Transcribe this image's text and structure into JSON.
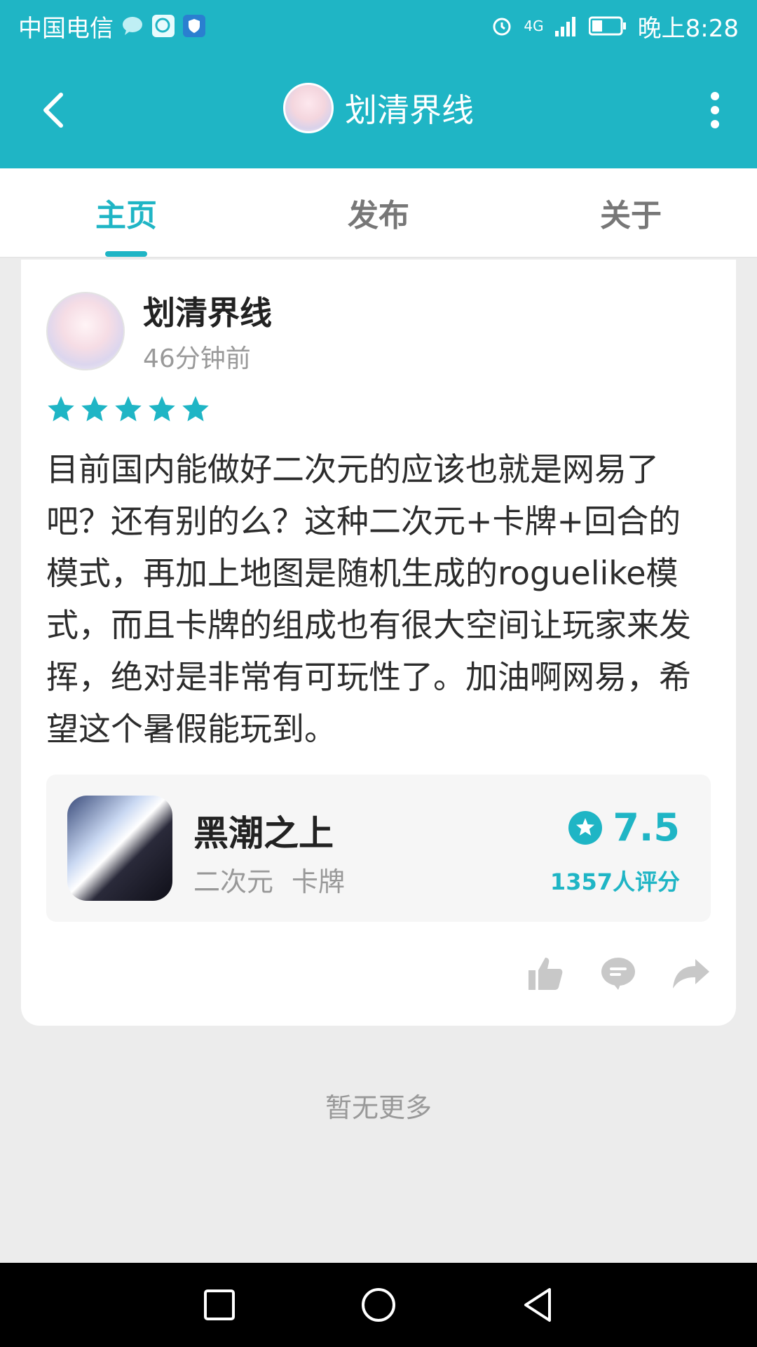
{
  "status_bar": {
    "carrier": "中国电信",
    "network": "4G",
    "time": "晚上8:28"
  },
  "header": {
    "title": "划清界线"
  },
  "tabs": [
    {
      "label": "主页",
      "active": true
    },
    {
      "label": "发布",
      "active": false
    },
    {
      "label": "关于",
      "active": false
    }
  ],
  "post": {
    "author": "划清界线",
    "time": "46分钟前",
    "rating_stars": 5,
    "text": "目前国内能做好二次元的应该也就是网易了吧？还有别的么？这种二次元+卡牌+回合的模式，再加上地图是随机生成的roguelike模式，而且卡牌的组成也有很大空间让玩家来发挥，绝对是非常有可玩性了。加油啊网易，希望这个暑假能玩到。",
    "game": {
      "name": "黑潮之上",
      "tags": [
        "二次元",
        "卡牌"
      ],
      "score": "7.5",
      "rating_count": "1357人评分"
    },
    "actions": [
      "thumbs-up-icon",
      "comment-icon",
      "share-icon"
    ]
  },
  "footer_text": "暂无更多",
  "colors": {
    "accent": "#1fb5c5",
    "background": "#ececec"
  }
}
